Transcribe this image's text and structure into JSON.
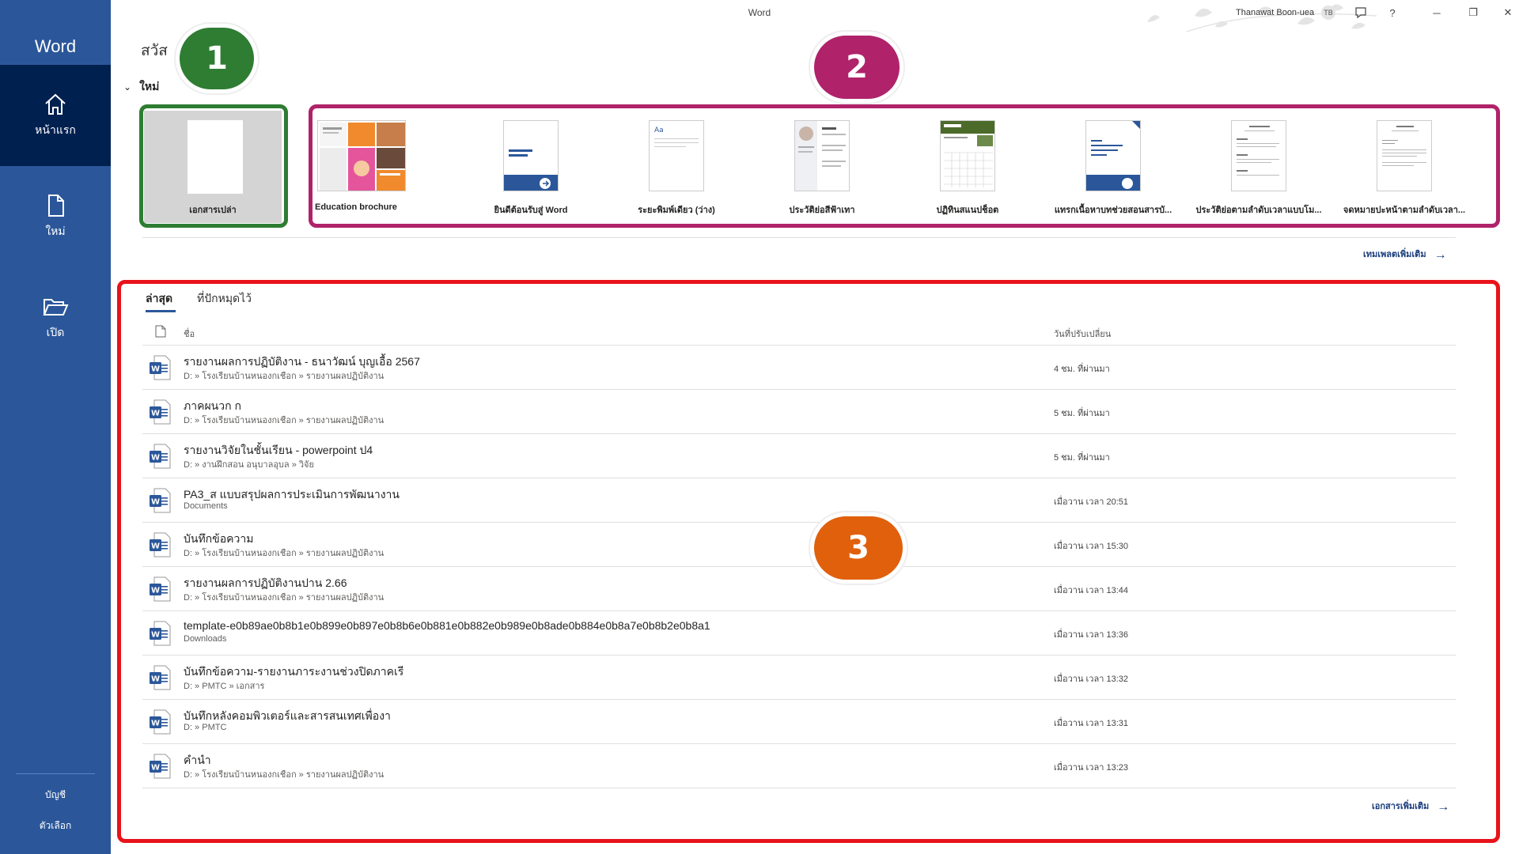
{
  "app": {
    "name": "Word",
    "window_title": "Word",
    "user_name": "Thanawat Boon-uea",
    "user_initials": "TB",
    "greeting": "สวัส",
    "accent_color": "#2b579a"
  },
  "sidebar": {
    "items": [
      {
        "label": "หน้าแรก",
        "icon": "home-icon"
      },
      {
        "label": "ใหม่",
        "icon": "new-document-icon"
      },
      {
        "label": "เปิด",
        "icon": "open-folder-icon"
      }
    ],
    "bottom": [
      {
        "label": "บัญชี"
      },
      {
        "label": "ตัวเลือก"
      }
    ]
  },
  "new_section": {
    "heading": "ใหม่",
    "blank": {
      "label": "เอกสารเปล่า"
    },
    "templates": [
      {
        "label": "Education brochure"
      },
      {
        "label": "ยินดีต้อนรับสู่ Word"
      },
      {
        "label": "ระยะพิมพ์เดียว (ว่าง)"
      },
      {
        "label": "ประวัติย่อสีฟ้าเทา"
      },
      {
        "label": "ปฏิทินสแนปช็อต"
      },
      {
        "label": "แทรกเนื้อหาบทช่วยสอนสารบั..."
      },
      {
        "label": "ประวัติย่อตามลำดับเวลาแบบโม..."
      },
      {
        "label": "จดหมายปะหน้าตามลำดับเวลา..."
      }
    ],
    "more_templates": "เทมเพลตเพิ่มเติม"
  },
  "recent": {
    "tabs": [
      "ล่าสุด",
      "ที่ปักหมุดไว้"
    ],
    "columns": {
      "name": "ชื่อ",
      "modified": "วันที่ปรับเปลี่ยน"
    },
    "files": [
      {
        "name": "รายงานผลการปฏิบัติงาน - ธนาวัฒน์ บุญเอื้อ 2567",
        "path": "D: » โรงเรียนบ้านหนองกเชือก » รายงานผลปฏิบัติงาน",
        "modified": "4 ชม. ที่ผ่านมา"
      },
      {
        "name": "ภาคผนวก ก",
        "path": "D: » โรงเรียนบ้านหนองกเชือก » รายงานผลปฏิบัติงาน",
        "modified": "5 ชม. ที่ผ่านมา"
      },
      {
        "name": "รายงานวิจัยในชั้นเรียน - powerpoint ป4",
        "path": "D: » งานฝึกสอน อนุบาลอุบล » วิจัย",
        "modified": "5 ชม. ที่ผ่านมา"
      },
      {
        "name": "PA3_ส แบบสรุปผลการประเมินการพัฒนางาน",
        "path": "Documents",
        "modified": "เมื่อวาน เวลา 20:51"
      },
      {
        "name": "บันทึกข้อความ",
        "path": "D: » โรงเรียนบ้านหนองกเชือก » รายงานผลปฏิบัติงาน",
        "modified": "เมื่อวาน เวลา 15:30"
      },
      {
        "name": "รายงานผลการปฏิบัติงานปาน 2.66",
        "path": "D: » โรงเรียนบ้านหนองกเชือก » รายงานผลปฏิบัติงาน",
        "modified": "เมื่อวาน เวลา 13:44"
      },
      {
        "name": "template-e0b89ae0b8b1e0b899e0b897e0b8b6e0b881e0b882e0b989e0b8ade0b884e0b8a7e0b8b2e0b8a1",
        "path": "Downloads",
        "modified": "เมื่อวาน เวลา 13:36"
      },
      {
        "name": "บันทึกข้อความ-รายงานภาระงานช่วงปิดภาคเรี",
        "path": "D: » PMTC » เอกสาร",
        "modified": "เมื่อวาน เวลา 13:32"
      },
      {
        "name": "บันทึกหลังคอมพิวเตอร์และสารสนเทศเพื่องา",
        "path": "D: » PMTC",
        "modified": "เมื่อวาน เวลา 13:31"
      },
      {
        "name": "คำนำ",
        "path": "D: » โรงเรียนบ้านหนองกเชือก » รายงานผลปฏิบัติงาน",
        "modified": "เมื่อวาน เวลา 13:23"
      }
    ],
    "more_documents": "เอกสารเพิ่มเติม"
  },
  "annotations": [
    {
      "label": "1",
      "color": "#2e7d32"
    },
    {
      "label": "2",
      "color": "#b0226a"
    },
    {
      "label": "3",
      "color": "#e0600c"
    }
  ]
}
